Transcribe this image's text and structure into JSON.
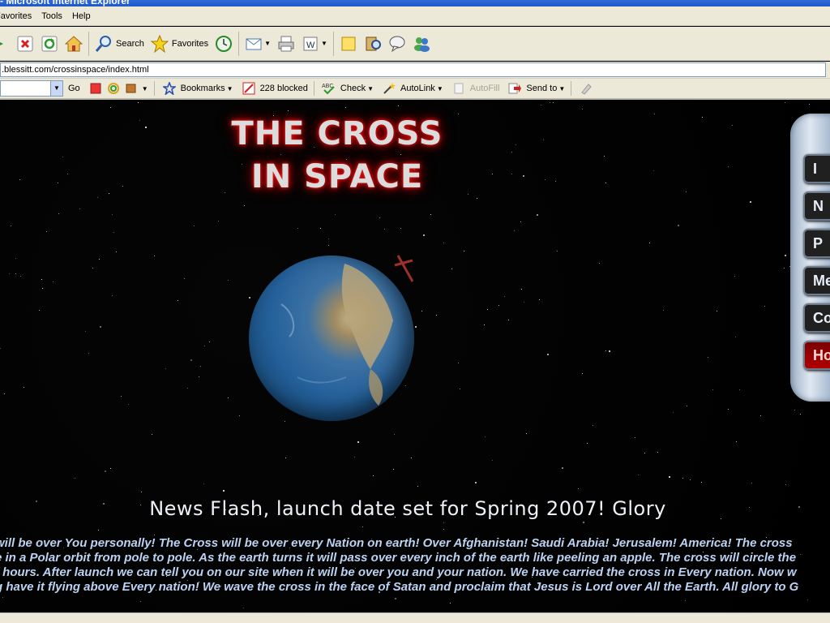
{
  "window": {
    "title": "- Microsoft Internet Explorer"
  },
  "menu": {
    "items": [
      "Favorites",
      "Tools",
      "Help"
    ]
  },
  "toolbar": {
    "search_label": "Search",
    "favorites_label": "Favorites"
  },
  "address": {
    "url": ".blessitt.com/crossinspace/index.html"
  },
  "links_bar": {
    "go_label": "Go",
    "bookmarks_label": "Bookmarks",
    "blocked_label": "228 blocked",
    "check_label": "Check",
    "autolink_label": "AutoLink",
    "autofill_label": "AutoFill",
    "sendto_label": "Send to"
  },
  "page": {
    "title_line1": "THE CROSS",
    "title_line2": "IN SPACE",
    "news_flash": "News Flash, launch date set for Spring 2007! Glory",
    "scroll_lines": [
      "will be over You personally! The Cross will be over every Nation on earth! Over Afghanistan! Saudi Arabia! Jerusalem! America! The cross",
      "e in a Polar orbit from pole to pole. As the earth turns it will pass over every inch of the earth like peeling an apple. The cross will circle the",
      "f hours. After launch we can tell you on our site when it will be over you and your nation. We have carried the cross in Every nation. Now w",
      "g have it flying above Every nation! We wave the cross in the face of Satan and proclaim that Jesus is Lord over All the Earth. All glory to G"
    ]
  },
  "nav_buttons": [
    "I",
    "N",
    "P",
    "Mes",
    "Co",
    "Ho"
  ]
}
